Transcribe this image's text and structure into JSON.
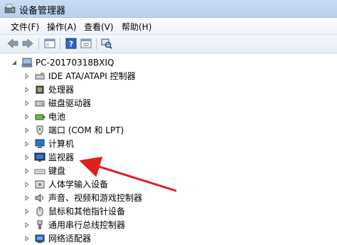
{
  "window": {
    "title": "设备管理器"
  },
  "menu": {
    "file": "文件(F)",
    "action": "操作(A)",
    "view": "查看(V)",
    "help": "帮助(H)"
  },
  "tree": {
    "root": "PC-20170318BXIQ",
    "items": [
      "IDE ATA/ATAPI 控制器",
      "处理器",
      "磁盘驱动器",
      "电池",
      "端口 (COM 和 LPT)",
      "计算机",
      "监视器",
      "键盘",
      "人体学输入设备",
      "声音、视频和游戏控制器",
      "鼠标和其他指针设备",
      "通用串行总线控制器",
      "网络适配器"
    ]
  },
  "annotation": {
    "arrow_color": "#e02020",
    "points_to": "监视器"
  }
}
